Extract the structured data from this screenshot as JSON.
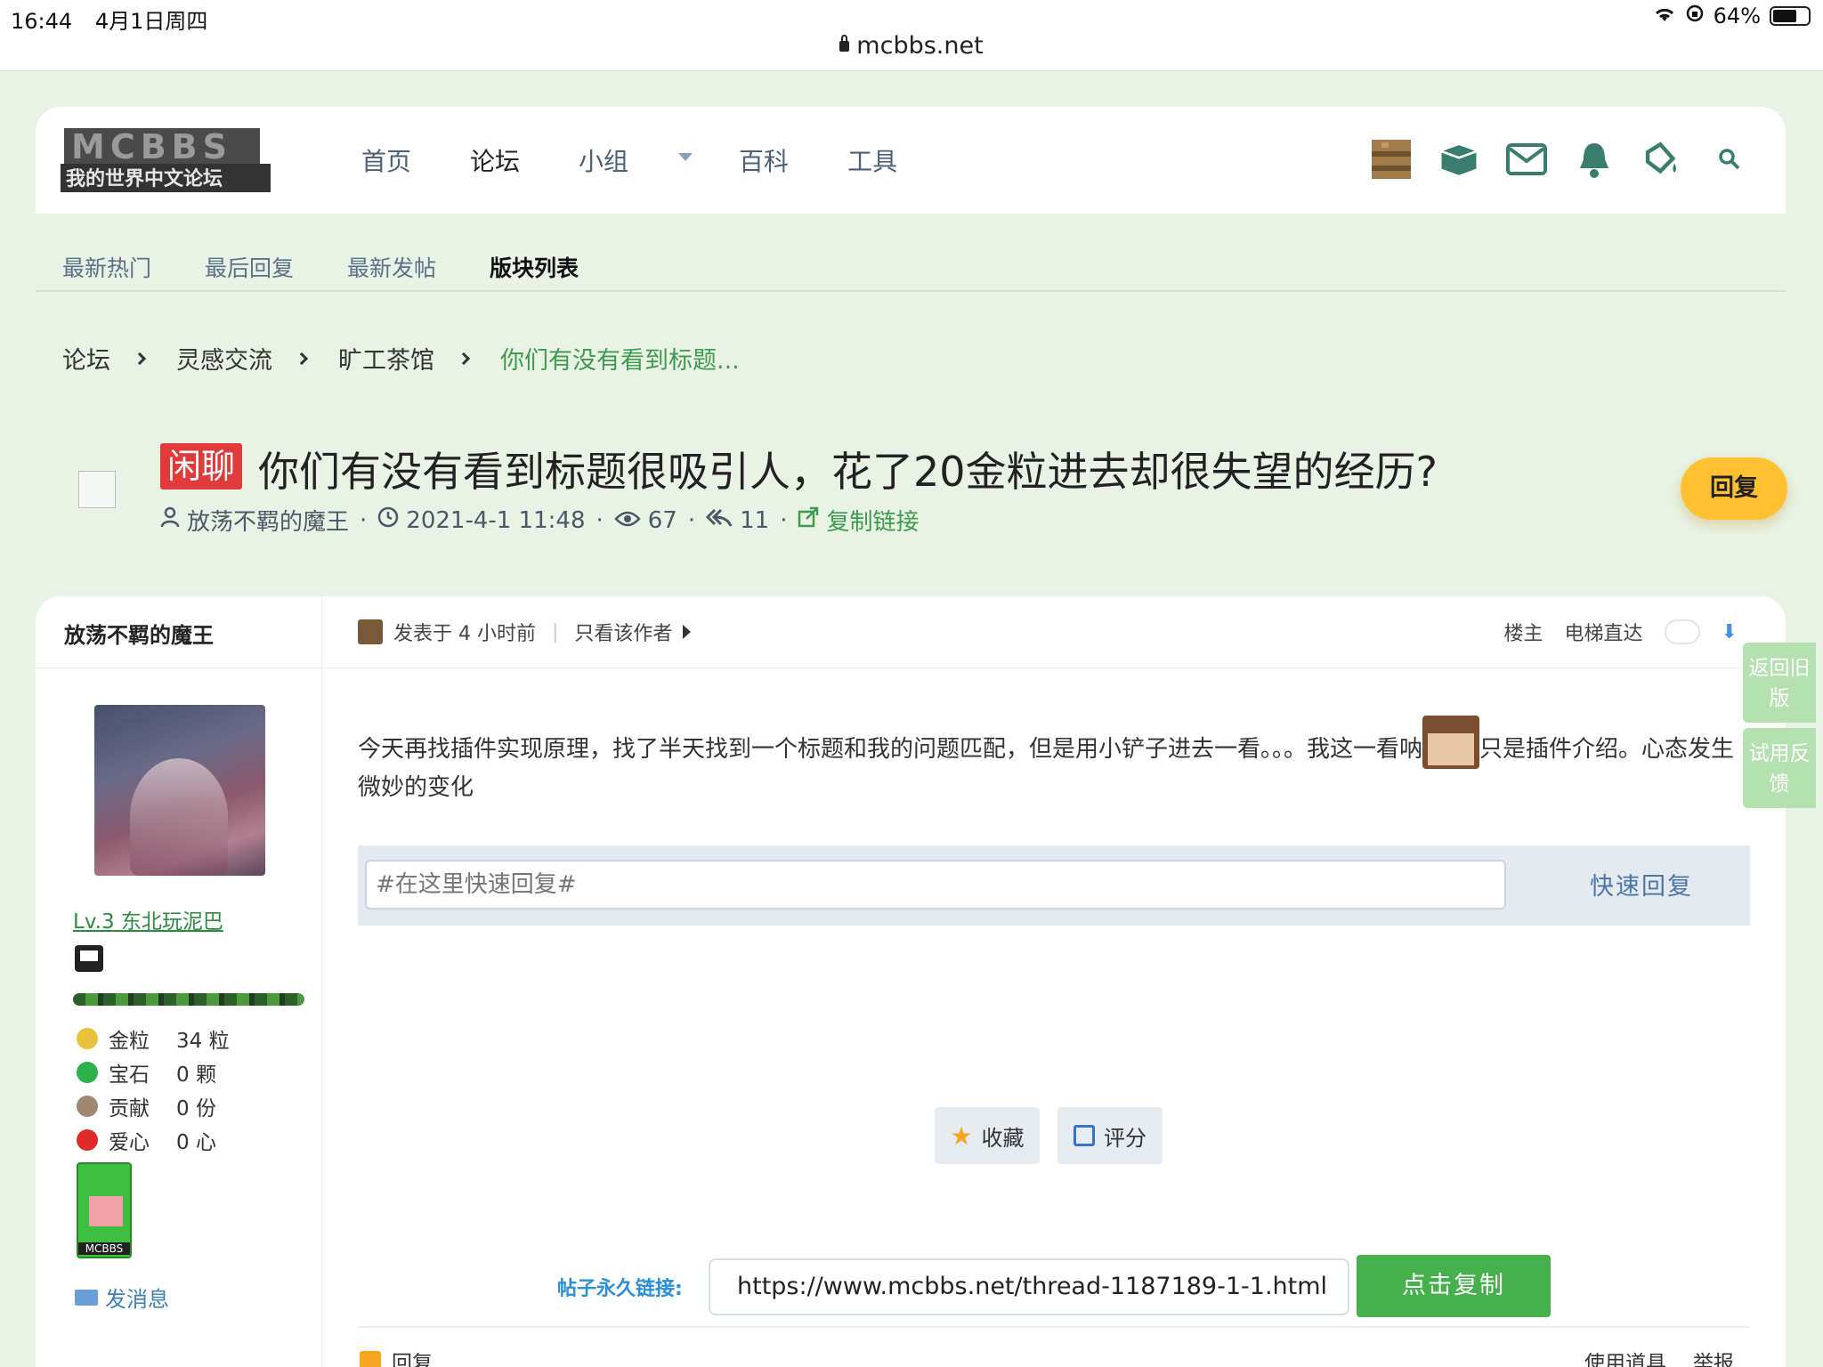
{
  "statusbar": {
    "time": "16:44",
    "date": "4月1日周四",
    "battery": "64%",
    "url": "mcbbs.net"
  },
  "header": {
    "logo_text": "MCBBS 我的世界中文论坛",
    "nav": [
      "首页",
      "论坛",
      "小组",
      "百科",
      "工具"
    ]
  },
  "subtabs": [
    "最新热门",
    "最后回复",
    "最新发帖",
    "版块列表"
  ],
  "breadcrumb": [
    "论坛",
    "灵感交流",
    "旷工茶馆",
    "你们有没有看到标题..."
  ],
  "thread": {
    "tag": "闲聊",
    "title": "你们有没有看到标题很吸引人，花了20金粒进去却很失望的经历?",
    "author": "放荡不羁的魔王",
    "time": "2021-4-1 11:48",
    "views": "67",
    "replies": "11",
    "copy_link": "复制链接",
    "reply_button": "回复"
  },
  "author_panel": {
    "name": "放荡不羁的魔王",
    "level": "Lv.3 东北玩泥巴",
    "stats": [
      {
        "label": "金粒",
        "value": "34 粒",
        "color": "#e8c23a"
      },
      {
        "label": "宝石",
        "value": "0 颗",
        "color": "#2bb24c"
      },
      {
        "label": "贡献",
        "value": "0 份",
        "color": "#a08870"
      },
      {
        "label": "爱心",
        "value": "0 心",
        "color": "#e02a2a"
      }
    ],
    "badge_text": "MCBBS",
    "send_message": "发消息"
  },
  "post": {
    "posted": "发表于 4 小时前",
    "only_author": "只看该作者",
    "floor": "楼主",
    "elevator": "电梯直达",
    "body_before": "今天再找插件实现原理，找了半天找到一个标题和我的问题匹配，但是用小铲子进去一看。。。我这一看呐",
    "body_after": "只是插件介绍。心态发生微妙的变化",
    "quick_reply_placeholder": "#在这里快速回复#",
    "quick_reply_button": "快速回复",
    "favorite": "收藏",
    "rate": "评分",
    "permalink_label": "帖子永久链接:",
    "permalink": "https://www.mcbbs.net/thread-1187189-1-1.html",
    "copy_button": "点击复制",
    "footer_reply": "回复",
    "footer_tools": "使用道具",
    "footer_report": "举报"
  },
  "side_tabs": [
    "返回旧版",
    "试用反馈"
  ]
}
